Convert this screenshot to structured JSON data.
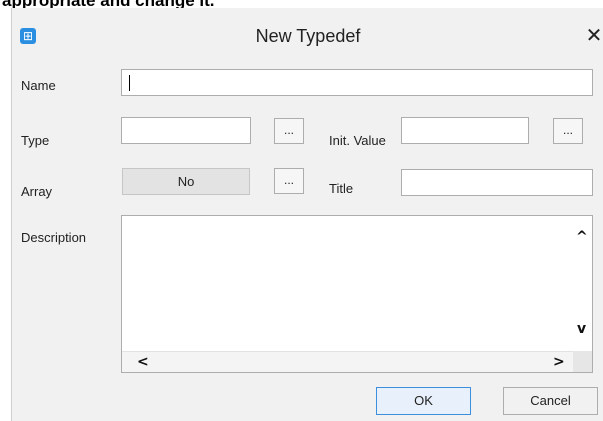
{
  "page_header": {
    "text": "appropriate and change it."
  },
  "dialog": {
    "title": "New Typedef",
    "app_icon": "typedef-icon",
    "close_icon": "close-icon"
  },
  "fields": {
    "name": {
      "label": "Name",
      "value": ""
    },
    "type": {
      "label": "Type",
      "value": "",
      "browse_label": "..."
    },
    "init_value": {
      "label": "Init. Value",
      "value": "",
      "browse_label": "..."
    },
    "array": {
      "label": "Array",
      "value": "No",
      "browse_label": "..."
    },
    "title": {
      "label": "Title",
      "value": ""
    },
    "description": {
      "label": "Description",
      "value": ""
    }
  },
  "scroll_arrows": {
    "up": "^",
    "down": "v",
    "left": "<",
    "right": ">"
  },
  "buttons": {
    "ok": "OK",
    "cancel": "Cancel"
  },
  "colors": {
    "ok_border": "#3c8fdc",
    "icon_bg": "#2a8fe0"
  }
}
